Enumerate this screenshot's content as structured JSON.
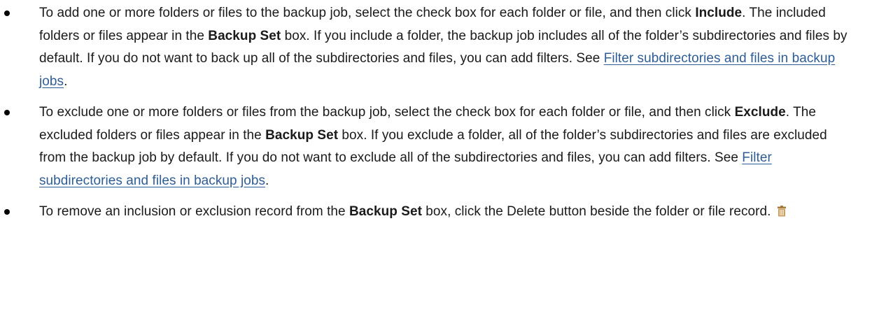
{
  "items": [
    {
      "p1": "To add one or more folders or files to the backup job, select the check box for each folder or file, and then click ",
      "b1": "Include",
      "p2": ". The included folders or files appear in the ",
      "b2": "Backup Set",
      "p3": " box. If you include a folder, the backup job includes all of the folder’s subdirectories and files by default. If you do not want to back up all of the subdirectories and files, you can add filters. See ",
      "link": "Filter subdirectories and files in backup jobs",
      "p4": "."
    },
    {
      "p1": "To exclude one or more folders or files from the backup job, select the check box for each folder or file, and then click ",
      "b1": "Exclude",
      "p2": ". The excluded folders or files appear in the ",
      "b2": "Backup Set",
      "p3": " box. If you exclude a folder, all of the folder’s subdirectories and files are excluded from the backup job by default. If you do not want to exclude all of the subdirectories and files, you can add filters. See ",
      "link": "Filter subdirectories and files in backup jobs",
      "p4": "."
    },
    {
      "p1": "To remove an inclusion or exclusion record from the ",
      "b1": "Backup Set",
      "p2": " box, click the Delete button beside the folder or file record.",
      "icon": "trash-icon"
    }
  ],
  "colors": {
    "text": "#1a1a1a",
    "link": "#2e5d96",
    "icon_body": "#c9a063",
    "icon_lid": "#a87a3c"
  }
}
